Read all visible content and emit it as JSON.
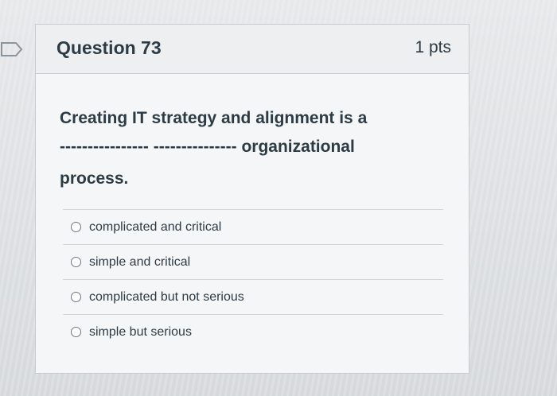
{
  "question": {
    "title": "Question 73",
    "points": "1 pts",
    "text_line1": "Creating IT strategy and alignment is a",
    "blank": "---------------- ---------------",
    "text_line2_tail": "organizational",
    "text_line3": "process.",
    "options": [
      {
        "label": "complicated and critical"
      },
      {
        "label": "simple and critical"
      },
      {
        "label": "complicated but not serious"
      },
      {
        "label": "simple but serious"
      }
    ]
  },
  "icons": {
    "flag": "bookmark-flag-icon",
    "radio": "radio-button-icon"
  },
  "colors": {
    "text": "#2d3b45",
    "card_bg": "#f5f6f7",
    "border": "#c8ccd0"
  }
}
